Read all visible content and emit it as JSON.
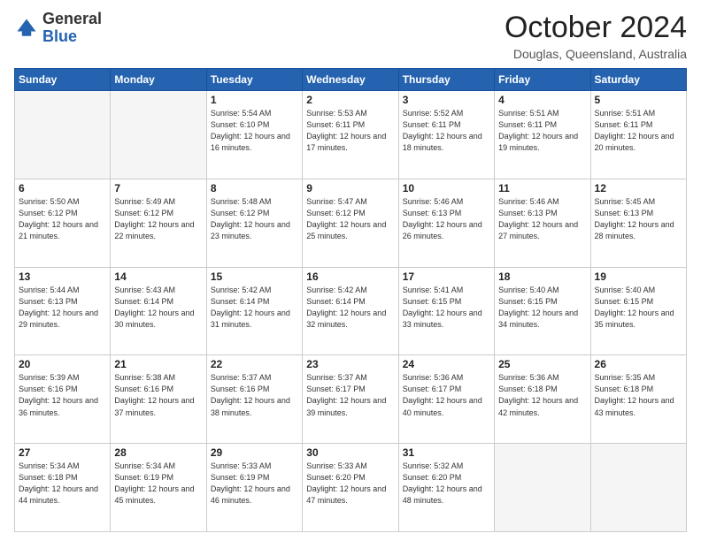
{
  "logo": {
    "general": "General",
    "blue": "Blue"
  },
  "title": "October 2024",
  "location": "Douglas, Queensland, Australia",
  "days_of_week": [
    "Sunday",
    "Monday",
    "Tuesday",
    "Wednesday",
    "Thursday",
    "Friday",
    "Saturday"
  ],
  "weeks": [
    [
      {
        "day": "",
        "info": ""
      },
      {
        "day": "",
        "info": ""
      },
      {
        "day": "1",
        "info": "Sunrise: 5:54 AM\nSunset: 6:10 PM\nDaylight: 12 hours and 16 minutes."
      },
      {
        "day": "2",
        "info": "Sunrise: 5:53 AM\nSunset: 6:11 PM\nDaylight: 12 hours and 17 minutes."
      },
      {
        "day": "3",
        "info": "Sunrise: 5:52 AM\nSunset: 6:11 PM\nDaylight: 12 hours and 18 minutes."
      },
      {
        "day": "4",
        "info": "Sunrise: 5:51 AM\nSunset: 6:11 PM\nDaylight: 12 hours and 19 minutes."
      },
      {
        "day": "5",
        "info": "Sunrise: 5:51 AM\nSunset: 6:11 PM\nDaylight: 12 hours and 20 minutes."
      }
    ],
    [
      {
        "day": "6",
        "info": "Sunrise: 5:50 AM\nSunset: 6:12 PM\nDaylight: 12 hours and 21 minutes."
      },
      {
        "day": "7",
        "info": "Sunrise: 5:49 AM\nSunset: 6:12 PM\nDaylight: 12 hours and 22 minutes."
      },
      {
        "day": "8",
        "info": "Sunrise: 5:48 AM\nSunset: 6:12 PM\nDaylight: 12 hours and 23 minutes."
      },
      {
        "day": "9",
        "info": "Sunrise: 5:47 AM\nSunset: 6:12 PM\nDaylight: 12 hours and 25 minutes."
      },
      {
        "day": "10",
        "info": "Sunrise: 5:46 AM\nSunset: 6:13 PM\nDaylight: 12 hours and 26 minutes."
      },
      {
        "day": "11",
        "info": "Sunrise: 5:46 AM\nSunset: 6:13 PM\nDaylight: 12 hours and 27 minutes."
      },
      {
        "day": "12",
        "info": "Sunrise: 5:45 AM\nSunset: 6:13 PM\nDaylight: 12 hours and 28 minutes."
      }
    ],
    [
      {
        "day": "13",
        "info": "Sunrise: 5:44 AM\nSunset: 6:13 PM\nDaylight: 12 hours and 29 minutes."
      },
      {
        "day": "14",
        "info": "Sunrise: 5:43 AM\nSunset: 6:14 PM\nDaylight: 12 hours and 30 minutes."
      },
      {
        "day": "15",
        "info": "Sunrise: 5:42 AM\nSunset: 6:14 PM\nDaylight: 12 hours and 31 minutes."
      },
      {
        "day": "16",
        "info": "Sunrise: 5:42 AM\nSunset: 6:14 PM\nDaylight: 12 hours and 32 minutes."
      },
      {
        "day": "17",
        "info": "Sunrise: 5:41 AM\nSunset: 6:15 PM\nDaylight: 12 hours and 33 minutes."
      },
      {
        "day": "18",
        "info": "Sunrise: 5:40 AM\nSunset: 6:15 PM\nDaylight: 12 hours and 34 minutes."
      },
      {
        "day": "19",
        "info": "Sunrise: 5:40 AM\nSunset: 6:15 PM\nDaylight: 12 hours and 35 minutes."
      }
    ],
    [
      {
        "day": "20",
        "info": "Sunrise: 5:39 AM\nSunset: 6:16 PM\nDaylight: 12 hours and 36 minutes."
      },
      {
        "day": "21",
        "info": "Sunrise: 5:38 AM\nSunset: 6:16 PM\nDaylight: 12 hours and 37 minutes."
      },
      {
        "day": "22",
        "info": "Sunrise: 5:37 AM\nSunset: 6:16 PM\nDaylight: 12 hours and 38 minutes."
      },
      {
        "day": "23",
        "info": "Sunrise: 5:37 AM\nSunset: 6:17 PM\nDaylight: 12 hours and 39 minutes."
      },
      {
        "day": "24",
        "info": "Sunrise: 5:36 AM\nSunset: 6:17 PM\nDaylight: 12 hours and 40 minutes."
      },
      {
        "day": "25",
        "info": "Sunrise: 5:36 AM\nSunset: 6:18 PM\nDaylight: 12 hours and 42 minutes."
      },
      {
        "day": "26",
        "info": "Sunrise: 5:35 AM\nSunset: 6:18 PM\nDaylight: 12 hours and 43 minutes."
      }
    ],
    [
      {
        "day": "27",
        "info": "Sunrise: 5:34 AM\nSunset: 6:18 PM\nDaylight: 12 hours and 44 minutes."
      },
      {
        "day": "28",
        "info": "Sunrise: 5:34 AM\nSunset: 6:19 PM\nDaylight: 12 hours and 45 minutes."
      },
      {
        "day": "29",
        "info": "Sunrise: 5:33 AM\nSunset: 6:19 PM\nDaylight: 12 hours and 46 minutes."
      },
      {
        "day": "30",
        "info": "Sunrise: 5:33 AM\nSunset: 6:20 PM\nDaylight: 12 hours and 47 minutes."
      },
      {
        "day": "31",
        "info": "Sunrise: 5:32 AM\nSunset: 6:20 PM\nDaylight: 12 hours and 48 minutes."
      },
      {
        "day": "",
        "info": ""
      },
      {
        "day": "",
        "info": ""
      }
    ]
  ]
}
